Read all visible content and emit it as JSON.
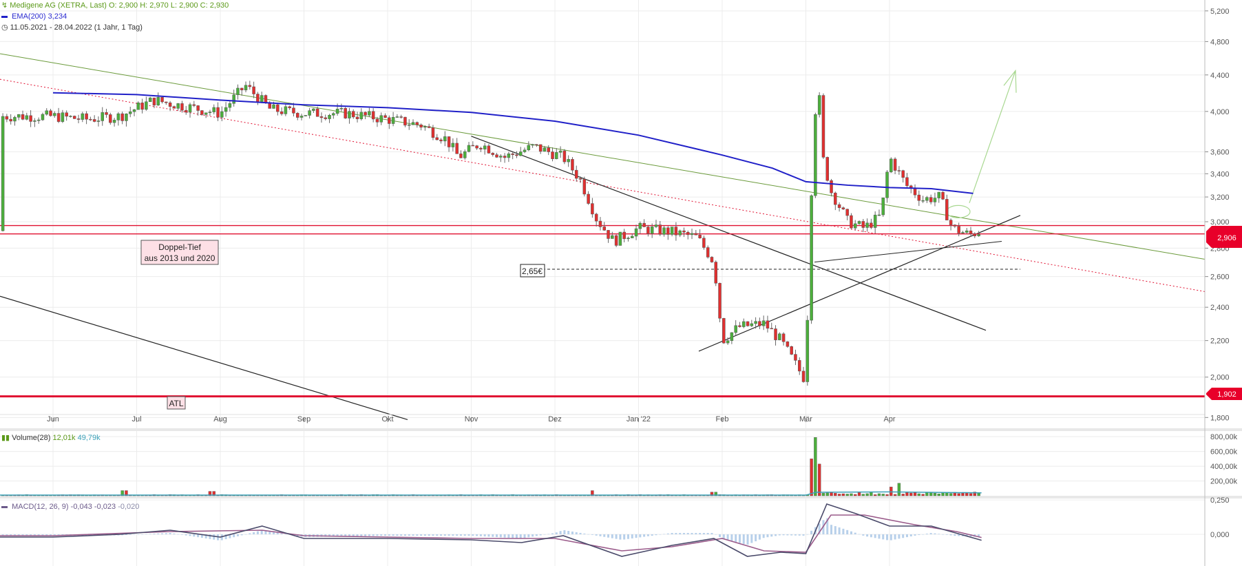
{
  "legend": {
    "instrument": "Medigene AG (XETRA, Last)",
    "ohlc": "O: 2,900  H: 2,970  L: 2,900  C: 2,930",
    "ema_label": "EMA(200)",
    "ema_value": "3,234",
    "range": "11.05.2021 - 28.04.2022   (1 Jahr, 1 Tag)",
    "volume_label": "Volume(28)",
    "volume_v1": "12,01k",
    "volume_v2": "49,79k",
    "macd_label": "MACD(12, 26, 9)",
    "macd_v1": "-0,043",
    "macd_v2": "-0,023",
    "macd_v3": "-0,020"
  },
  "annotations": {
    "doppel_tief_line1": "Doppel-Tief",
    "doppel_tief_line2": "aus 2013 und 2020",
    "atl": "ATL",
    "level_265": "2,65€",
    "price_tag_current": "2,906",
    "price_tag_atl": "1,902"
  },
  "colors": {
    "up": "#4caf3c",
    "down": "#e03030",
    "ema": "#2020c8",
    "downtrend_green": "#6a9a3a",
    "support_red": "#e01030",
    "macd": "#6b5a8a"
  },
  "chart_data": [
    {
      "type": "candlestick",
      "title": "Medigene AG (XETRA, Last)",
      "period": "11.05.2021 - 28.04.2022",
      "x_ticks": [
        "Jun",
        "Jul",
        "Aug",
        "Sep",
        "Okt",
        "Nov",
        "Dez",
        "Jan '22",
        "Feb",
        "Mär",
        "Apr"
      ],
      "y_ticks": [
        "1,800",
        "2,000",
        "2,200",
        "2,400",
        "2,600",
        "2,800",
        "3,000",
        "3,200",
        "3,400",
        "3,600",
        "4,000",
        "4,400",
        "4,800",
        "5,200"
      ],
      "y_range": [
        1.75,
        5.35
      ],
      "y_scale": "log",
      "grid": true,
      "series_points": [
        {
          "m": 0.0,
          "p": 3.95
        },
        {
          "m": 0.4,
          "p": 3.92
        },
        {
          "m": 0.8,
          "p": 3.95
        },
        {
          "m": 1.2,
          "p": 4.12
        },
        {
          "m": 1.6,
          "p": 4.05
        },
        {
          "m": 2.0,
          "p": 3.98
        },
        {
          "m": 2.3,
          "p": 4.28
        },
        {
          "m": 2.6,
          "p": 4.02
        },
        {
          "m": 3.0,
          "p": 3.98
        },
        {
          "m": 3.5,
          "p": 3.98
        },
        {
          "m": 4.0,
          "p": 3.92
        },
        {
          "m": 4.4,
          "p": 3.86
        },
        {
          "m": 4.7,
          "p": 3.72
        },
        {
          "m": 4.85,
          "p": 3.55
        },
        {
          "m": 5.1,
          "p": 3.68
        },
        {
          "m": 5.4,
          "p": 3.55
        },
        {
          "m": 5.75,
          "p": 3.65
        },
        {
          "m": 6.1,
          "p": 3.55
        },
        {
          "m": 6.3,
          "p": 3.35
        },
        {
          "m": 6.5,
          "p": 3.02
        },
        {
          "m": 6.7,
          "p": 2.85
        },
        {
          "m": 7.0,
          "p": 2.95
        },
        {
          "m": 7.4,
          "p": 2.92
        },
        {
          "m": 7.7,
          "p": 2.88
        },
        {
          "m": 7.9,
          "p": 2.7
        },
        {
          "m": 8.0,
          "p": 2.2
        },
        {
          "m": 8.2,
          "p": 2.28
        },
        {
          "m": 8.5,
          "p": 2.3
        },
        {
          "m": 8.7,
          "p": 2.2
        },
        {
          "m": 8.9,
          "p": 2.05
        },
        {
          "m": 9.0,
          "p": 1.98
        },
        {
          "m": 9.1,
          "p": 3.9
        },
        {
          "m": 9.15,
          "p": 4.3
        },
        {
          "m": 9.2,
          "p": 3.55
        },
        {
          "m": 9.3,
          "p": 3.25
        },
        {
          "m": 9.5,
          "p": 3.0
        },
        {
          "m": 9.7,
          "p": 2.95
        },
        {
          "m": 9.9,
          "p": 3.05
        },
        {
          "m": 10.0,
          "p": 3.55
        },
        {
          "m": 10.2,
          "p": 3.3
        },
        {
          "m": 10.4,
          "p": 3.18
        },
        {
          "m": 10.6,
          "p": 3.2
        },
        {
          "m": 10.75,
          "p": 2.95
        },
        {
          "m": 10.95,
          "p": 2.9
        },
        {
          "m": 11.1,
          "p": 2.93
        }
      ],
      "ema200": [
        {
          "m": 0.0,
          "p": 4.2
        },
        {
          "m": 1.0,
          "p": 4.18
        },
        {
          "m": 2.0,
          "p": 4.12
        },
        {
          "m": 3.0,
          "p": 4.07
        },
        {
          "m": 4.0,
          "p": 4.04
        },
        {
          "m": 5.0,
          "p": 3.99
        },
        {
          "m": 6.0,
          "p": 3.9
        },
        {
          "m": 7.0,
          "p": 3.76
        },
        {
          "m": 8.0,
          "p": 3.57
        },
        {
          "m": 8.6,
          "p": 3.45
        },
        {
          "m": 9.0,
          "p": 3.33
        },
        {
          "m": 9.5,
          "p": 3.3
        },
        {
          "m": 10.0,
          "p": 3.28
        },
        {
          "m": 10.5,
          "p": 3.27
        },
        {
          "m": 11.0,
          "p": 3.23
        }
      ],
      "annotation_levels": [
        2.65,
        1.902,
        2.906,
        2.97
      ]
    },
    {
      "type": "bar",
      "title": "Volume(28)",
      "y_ticks": [
        "200,00k",
        "400,00k",
        "600,00k",
        "800,00k"
      ],
      "y_range": [
        0,
        820000
      ],
      "spikes": [
        {
          "m": 0.85,
          "v": 70000
        },
        {
          "m": 1.9,
          "v": 60000
        },
        {
          "m": 6.45,
          "v": 70000
        },
        {
          "m": 7.9,
          "v": 50000
        },
        {
          "m": 9.08,
          "v": 500000
        },
        {
          "m": 9.12,
          "v": 790000
        },
        {
          "m": 9.17,
          "v": 430000
        },
        {
          "m": 10.0,
          "v": 120000
        },
        {
          "m": 10.1,
          "v": 170000
        }
      ]
    },
    {
      "type": "line",
      "title": "MACD(12, 26, 9)",
      "y_ticks": [
        "0,250",
        "0,000"
      ],
      "macd": [
        {
          "m": 0.0,
          "v": -0.02
        },
        {
          "m": 0.8,
          "v": 0.0
        },
        {
          "m": 1.4,
          "v": 0.03
        },
        {
          "m": 2.0,
          "v": -0.02
        },
        {
          "m": 2.5,
          "v": 0.06
        },
        {
          "m": 3.0,
          "v": -0.03
        },
        {
          "m": 4.0,
          "v": -0.03
        },
        {
          "m": 5.0,
          "v": -0.04
        },
        {
          "m": 5.6,
          "v": -0.06
        },
        {
          "m": 6.1,
          "v": -0.01
        },
        {
          "m": 6.8,
          "v": -0.16
        },
        {
          "m": 7.4,
          "v": -0.08
        },
        {
          "m": 7.9,
          "v": -0.03
        },
        {
          "m": 8.3,
          "v": -0.16
        },
        {
          "m": 8.7,
          "v": -0.13
        },
        {
          "m": 9.0,
          "v": -0.14
        },
        {
          "m": 9.25,
          "v": 0.22
        },
        {
          "m": 9.6,
          "v": 0.15
        },
        {
          "m": 10.0,
          "v": 0.06
        },
        {
          "m": 10.5,
          "v": 0.06
        },
        {
          "m": 11.1,
          "v": -0.043
        }
      ],
      "signal": [
        {
          "m": 0.0,
          "v": -0.01
        },
        {
          "m": 1.4,
          "v": 0.02
        },
        {
          "m": 2.5,
          "v": 0.03
        },
        {
          "m": 3.0,
          "v": -0.01
        },
        {
          "m": 4.0,
          "v": -0.02
        },
        {
          "m": 5.0,
          "v": -0.03
        },
        {
          "m": 6.0,
          "v": -0.03
        },
        {
          "m": 6.8,
          "v": -0.12
        },
        {
          "m": 7.4,
          "v": -0.09
        },
        {
          "m": 8.0,
          "v": -0.03
        },
        {
          "m": 8.5,
          "v": -0.12
        },
        {
          "m": 9.0,
          "v": -0.13
        },
        {
          "m": 9.3,
          "v": 0.14
        },
        {
          "m": 9.7,
          "v": 0.14
        },
        {
          "m": 10.3,
          "v": 0.07
        },
        {
          "m": 10.8,
          "v": 0.02
        },
        {
          "m": 11.1,
          "v": -0.023
        }
      ]
    }
  ]
}
